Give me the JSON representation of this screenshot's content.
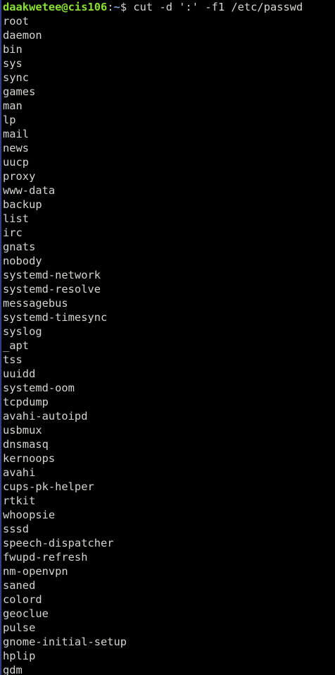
{
  "prompt": {
    "user_host": "daakwetee@cis106",
    "separator": ":",
    "path": "~",
    "symbol": "$ ",
    "command": "cut -d ':' -f1 /etc/passwd"
  },
  "output": [
    "root",
    "daemon",
    "bin",
    "sys",
    "sync",
    "games",
    "man",
    "lp",
    "mail",
    "news",
    "uucp",
    "proxy",
    "www-data",
    "backup",
    "list",
    "irc",
    "gnats",
    "nobody",
    "systemd-network",
    "systemd-resolve",
    "messagebus",
    "systemd-timesync",
    "syslog",
    "_apt",
    "tss",
    "uuidd",
    "systemd-oom",
    "tcpdump",
    "avahi-autoipd",
    "usbmux",
    "dnsmasq",
    "kernoops",
    "avahi",
    "cups-pk-helper",
    "rtkit",
    "whoopsie",
    "sssd",
    "speech-dispatcher",
    "fwupd-refresh",
    "nm-openvpn",
    "saned",
    "colord",
    "geoclue",
    "pulse",
    "gnome-initial-setup",
    "hplip",
    "gdm"
  ],
  "colors": {
    "background": "#000000",
    "text": "#d3d7cf",
    "user_host": "#8ae234",
    "path": "#729fcf"
  }
}
